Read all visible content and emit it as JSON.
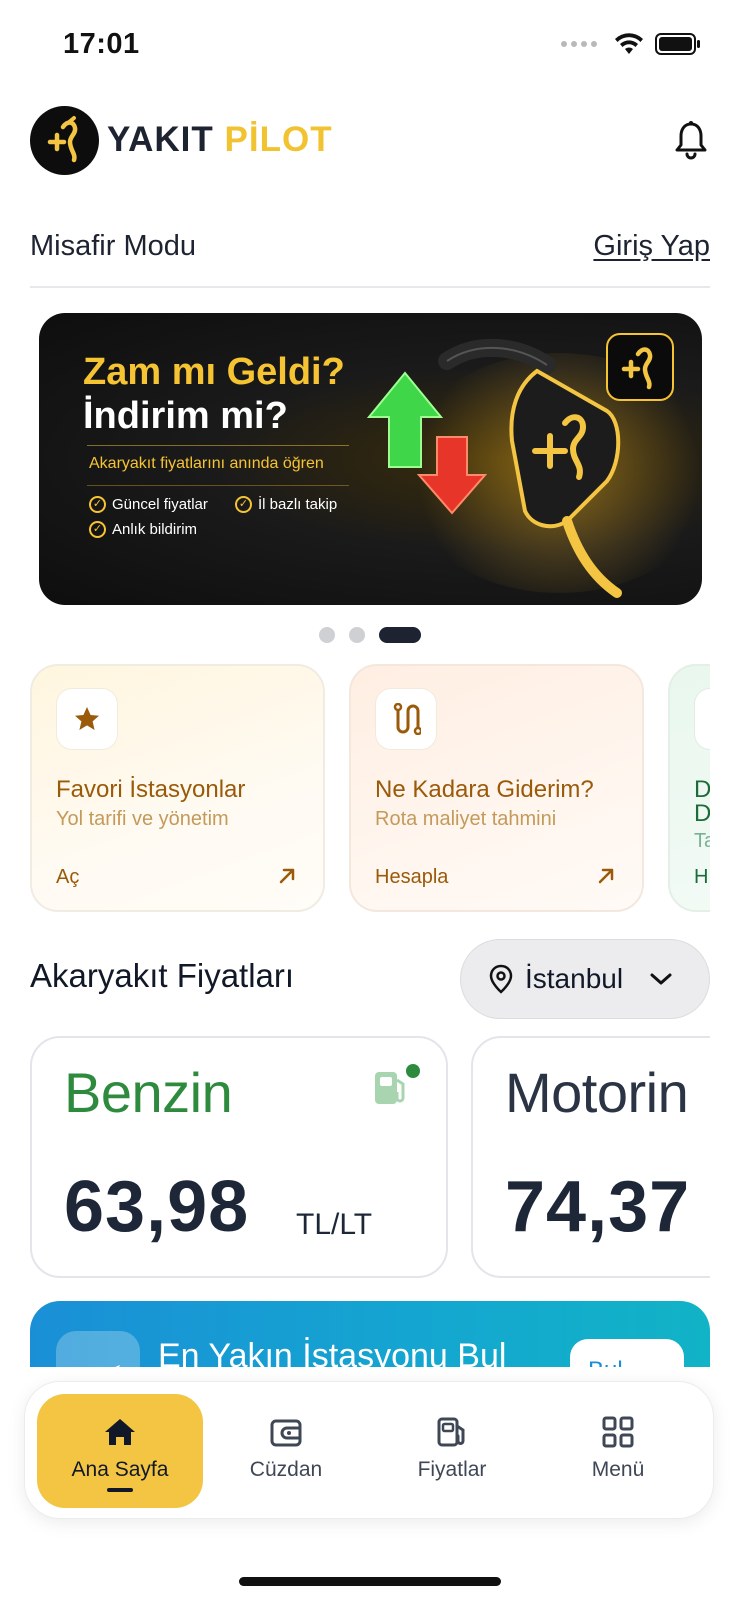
{
  "status_bar": {
    "time": "17:01"
  },
  "header": {
    "brand_part1": "YAKIT",
    "brand_part2": "PİLOT",
    "icons": {
      "logo": "fuel-nozzle-logo-icon",
      "notifications": "bell-icon"
    }
  },
  "guest": {
    "mode_label": "Misafir Modu",
    "login_label": "Giriş Yap"
  },
  "promo_banner": {
    "title_line1": "Zam mı Geldi?",
    "title_line2": "İndirim mi?",
    "subtitle": "Akaryakıt fiyatlarını anında öğren",
    "features": [
      "Güncel fiyatlar",
      "İl bazlı takip",
      "Anlık bildirim"
    ],
    "slide_count": 3,
    "active_slide": 3
  },
  "quick_actions": [
    {
      "title": "Favori İstasyonlar",
      "subtitle": "Yol tarifi ve yönetim",
      "action": "Aç",
      "icon": "star-icon"
    },
    {
      "title": "Ne Kadara Giderim?",
      "subtitle": "Rota maliyet tahmini",
      "action": "Hesapla",
      "icon": "route-icon"
    },
    {
      "title": "D",
      "title_line2": "D",
      "subtitle": "Ta",
      "action": "H",
      "icon": "partial-icon"
    }
  ],
  "prices": {
    "section_title": "Akaryakıt Fiyatları",
    "city": "İstanbul",
    "items": [
      {
        "name": "Benzin",
        "value": "63,98",
        "unit": "TL/LT"
      },
      {
        "name": "Motorin",
        "value": "74,37"
      }
    ]
  },
  "nearest_station": {
    "title": "En Yakın İstasyonu Bul",
    "button_label": "Bul"
  },
  "bottom_nav": [
    {
      "label": "Ana Sayfa",
      "icon": "home-icon",
      "active": true
    },
    {
      "label": "Cüzdan",
      "icon": "wallet-icon",
      "active": false
    },
    {
      "label": "Fiyatlar",
      "icon": "fuel-pump-icon",
      "active": false
    },
    {
      "label": "Menü",
      "icon": "grid-icon",
      "active": false
    }
  ],
  "colors": {
    "brand_yellow": "#f4c542",
    "brand_dark": "#1d2330",
    "benzin_green": "#2e8b3e",
    "nearest_blue": "#1a8fd6"
  }
}
